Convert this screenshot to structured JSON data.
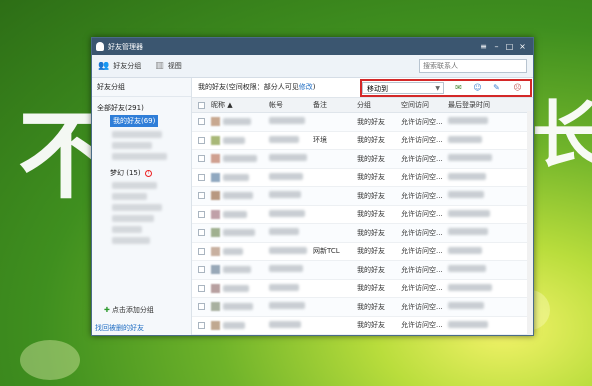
{
  "window": {
    "title": "好友管理器",
    "buttons": [
      "≡",
      "–",
      "□",
      "×"
    ]
  },
  "toolbar": {
    "friend_group_label": "好友分组",
    "view_label": "视图",
    "search_placeholder": "搜索联系人"
  },
  "sidebar": {
    "header": "好友分组",
    "all_friends": "全部好友(291)",
    "my_friends": "我的好友(69)",
    "group2": "梦幻 (15)",
    "add_group": "点击添加分组",
    "find_deleted": "找回被删的好友"
  },
  "permission": {
    "text": "我的好友(空间权限：部分人可见",
    "link": "修改",
    "close": ")"
  },
  "moveto": {
    "label": "移动到"
  },
  "columns": {
    "nickname": "昵称 ▲",
    "account": "帐号",
    "note": "备注",
    "group": "分组",
    "space": "空间访问",
    "login": "最后登录时间"
  },
  "rows": [
    {
      "note": "",
      "group": "我的好友",
      "space": "允许访问空..."
    },
    {
      "note": "环境",
      "group": "我的好友",
      "space": "允许访问空..."
    },
    {
      "note": "",
      "group": "我的好友",
      "space": "允许访问空..."
    },
    {
      "note": "",
      "group": "我的好友",
      "space": "允许访问空..."
    },
    {
      "note": "",
      "group": "我的好友",
      "space": "允许访问空..."
    },
    {
      "note": "",
      "group": "我的好友",
      "space": "允许访问空..."
    },
    {
      "note": "",
      "group": "我的好友",
      "space": "允许访问空..."
    },
    {
      "note": "网新TCL",
      "group": "我的好友",
      "space": "允许访问空..."
    },
    {
      "note": "",
      "group": "我的好友",
      "space": "允许访问空..."
    },
    {
      "note": "",
      "group": "我的好友",
      "space": "允许访问空..."
    },
    {
      "note": "",
      "group": "我的好友",
      "space": "允许访问空..."
    },
    {
      "note": "",
      "group": "我的好友",
      "space": "允许访问空..."
    }
  ],
  "background": {
    "glyph_left": "不",
    "glyph_right": "长"
  },
  "colors": {
    "titlebar": "#3b5670",
    "selected": "#2f7ed8",
    "highlight_box": "#d42828"
  }
}
